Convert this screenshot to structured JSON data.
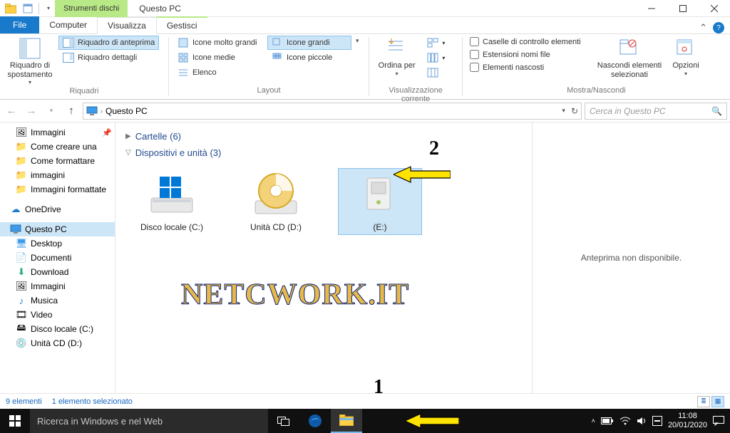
{
  "titlebar": {
    "context_tab": "Strumenti dischi",
    "title": "Questo PC"
  },
  "tabs": {
    "file": "File",
    "computer": "Computer",
    "view": "Visualizza",
    "manage": "Gestisci"
  },
  "ribbon": {
    "panes": {
      "nav_btn": "Riquadro di spostamento",
      "preview_pane": "Riquadro di anteprima",
      "details_pane": "Riquadro dettagli",
      "group_label": "Riquadri"
    },
    "layout": {
      "extra_large": "Icone molto grandi",
      "large": "Icone grandi",
      "medium": "Icone medie",
      "small": "Icone piccole",
      "list": "Elenco",
      "group_label": "Layout"
    },
    "current": {
      "sort": "Ordina per",
      "group_label": "Visualizzazione corrente"
    },
    "showhide": {
      "checkboxes": "Caselle di controllo elementi",
      "extensions": "Estensioni nomi file",
      "hidden": "Elementi nascosti",
      "hide_selected": "Nascondi elementi selezionati",
      "options": "Opzioni",
      "group_label": "Mostra/Nascondi"
    }
  },
  "nav": {
    "location": "Questo PC",
    "search_placeholder": "Cerca in Questo PC"
  },
  "side": {
    "quick": [
      "Immagini",
      "Come creare una",
      "Come formattare",
      "immagini",
      "Immagini formattate"
    ],
    "onedrive": "OneDrive",
    "thispc": "Questo PC",
    "thispc_children": [
      "Desktop",
      "Documenti",
      "Download",
      "Immagini",
      "Musica",
      "Video",
      "Disco locale (C:)",
      "Unità CD (D:)"
    ]
  },
  "main": {
    "folders_header": "Cartelle (6)",
    "devices_header": "Dispositivi e unità (3)",
    "drives": [
      {
        "label": "Disco locale (C:)"
      },
      {
        "label": "Unità CD (D:)"
      },
      {
        "label": "(E:)"
      }
    ],
    "preview_placeholder": "Anteprima non disponibile."
  },
  "annotations": {
    "n1": "1",
    "n2": "2",
    "watermark": "NETCWORK.IT"
  },
  "status": {
    "count": "9 elementi",
    "selection": "1 elemento selezionato"
  },
  "taskbar": {
    "search_placeholder": "Ricerca in Windows e nel Web",
    "time": "11:08",
    "date": "20/01/2020"
  }
}
